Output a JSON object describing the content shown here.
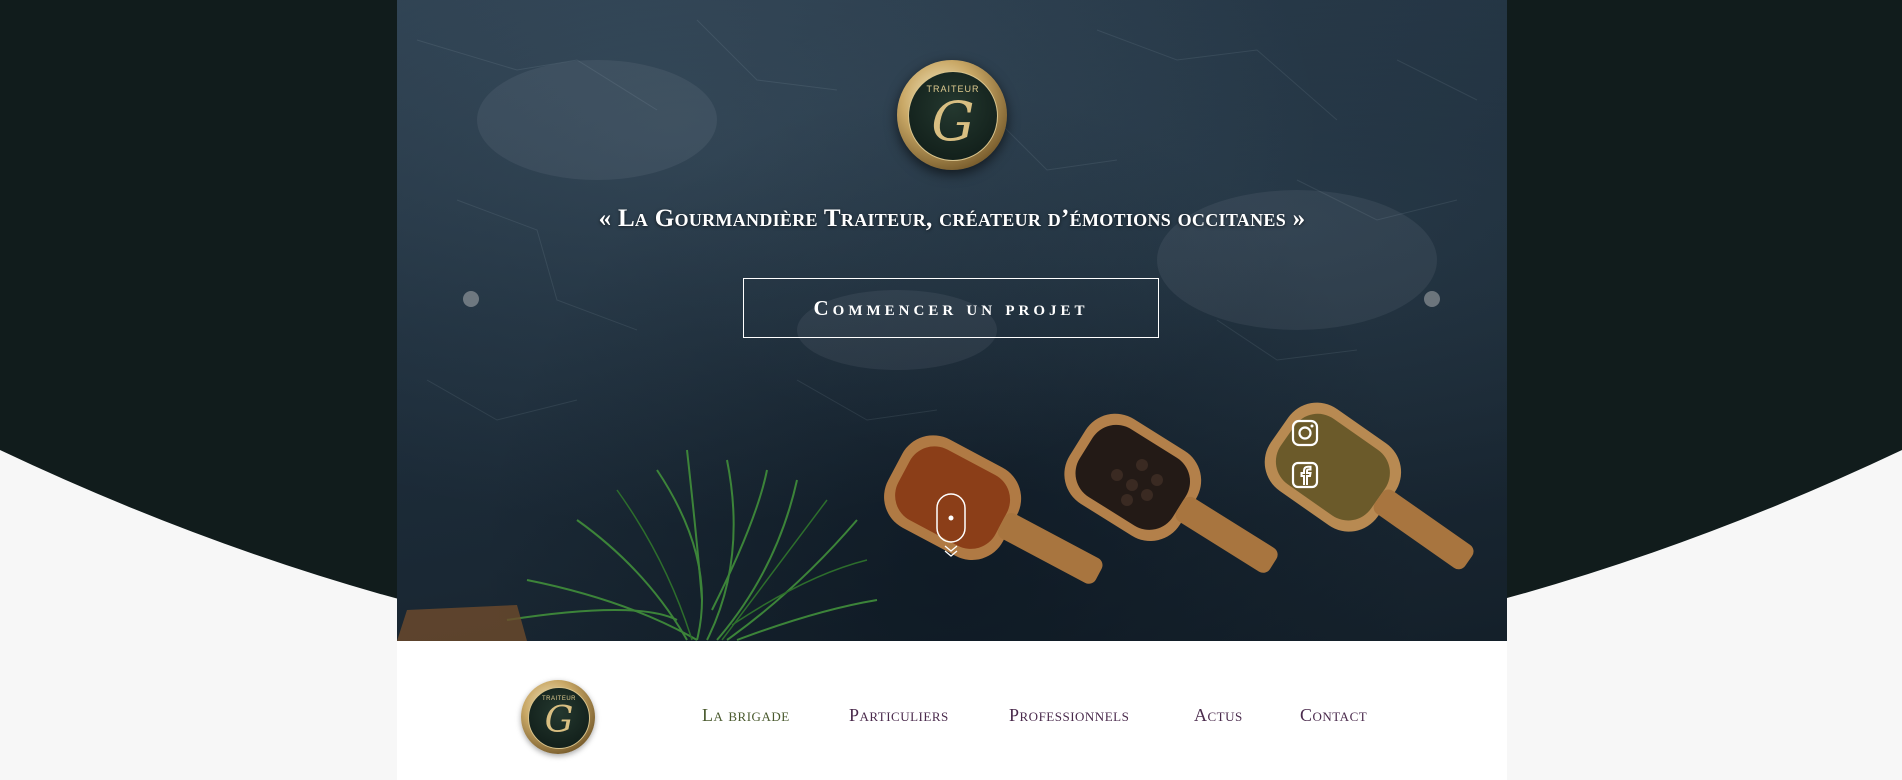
{
  "colors": {
    "page_dark": "#111c1c",
    "page_light": "#f7f7f7",
    "text_light": "#ffffff",
    "gold": "#d9bf82",
    "nav_text": "#4a2a4c",
    "nav_active": "#4a5a2e"
  },
  "hero": {
    "logo": {
      "top_text": "TRAITEUR",
      "monogram": "G"
    },
    "tagline": "« La Gourmandière Traiteur, créateur d’émotions occitanes »",
    "cta_label": "Commencer un projet",
    "slider_prev_icon": "dot-icon",
    "slider_next_icon": "dot-icon",
    "social": [
      {
        "name": "instagram",
        "icon": "instagram-icon"
      },
      {
        "name": "facebook",
        "icon": "facebook-icon"
      }
    ],
    "scroll_icon": "mouse-scroll-icon"
  },
  "nav": {
    "logo": {
      "top_text": "TRAITEUR",
      "monogram": "G"
    },
    "items": [
      {
        "label": "La brigade",
        "active": true
      },
      {
        "label": "Particuliers",
        "active": false
      },
      {
        "label": "Professionnels",
        "active": false
      },
      {
        "label": "Actus",
        "active": false
      },
      {
        "label": "Contact",
        "active": false
      }
    ]
  }
}
